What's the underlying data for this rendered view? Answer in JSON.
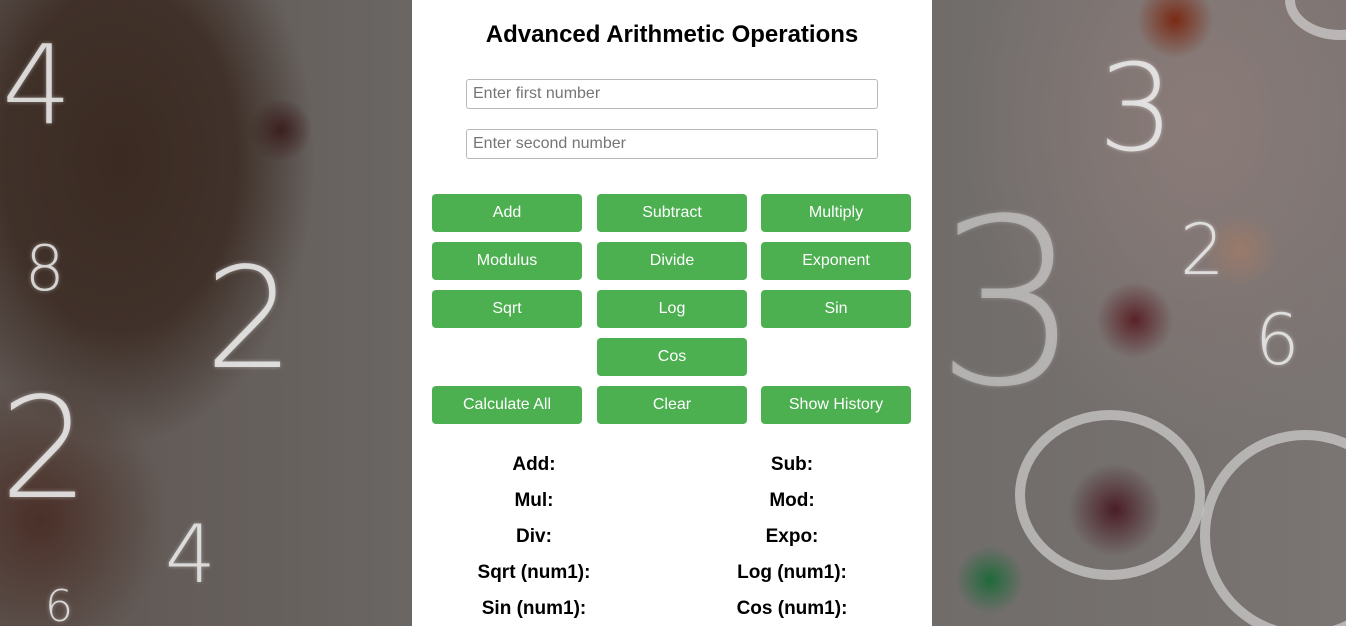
{
  "header": {
    "title": "Advanced Arithmetic Operations"
  },
  "inputs": {
    "first": {
      "placeholder": "Enter first number",
      "value": ""
    },
    "second": {
      "placeholder": "Enter second number",
      "value": ""
    }
  },
  "buttons": {
    "add": "Add",
    "subtract": "Subtract",
    "multiply": "Multiply",
    "modulus": "Modulus",
    "divide": "Divide",
    "exponent": "Exponent",
    "sqrt": "Sqrt",
    "log": "Log",
    "sin": "Sin",
    "cos": "Cos",
    "calculate_all": "Calculate All",
    "clear": "Clear",
    "show_history": "Show History"
  },
  "results": {
    "add": "Add:",
    "sub": "Sub:",
    "mul": "Mul:",
    "mod": "Mod:",
    "div": "Div:",
    "expo": "Expo:",
    "sqrt": "Sqrt (num1):",
    "log": "Log (num1):",
    "sin": "Sin (num1):",
    "cos": "Cos (num1):"
  },
  "background": {
    "chalk_digits": [
      "4",
      "8",
      "2",
      "2",
      "4",
      "6",
      "3",
      "2",
      "6",
      "3"
    ]
  },
  "colors": {
    "button_bg": "#4caf50",
    "button_text": "#ffffff",
    "panel_bg": "#ffffff"
  }
}
